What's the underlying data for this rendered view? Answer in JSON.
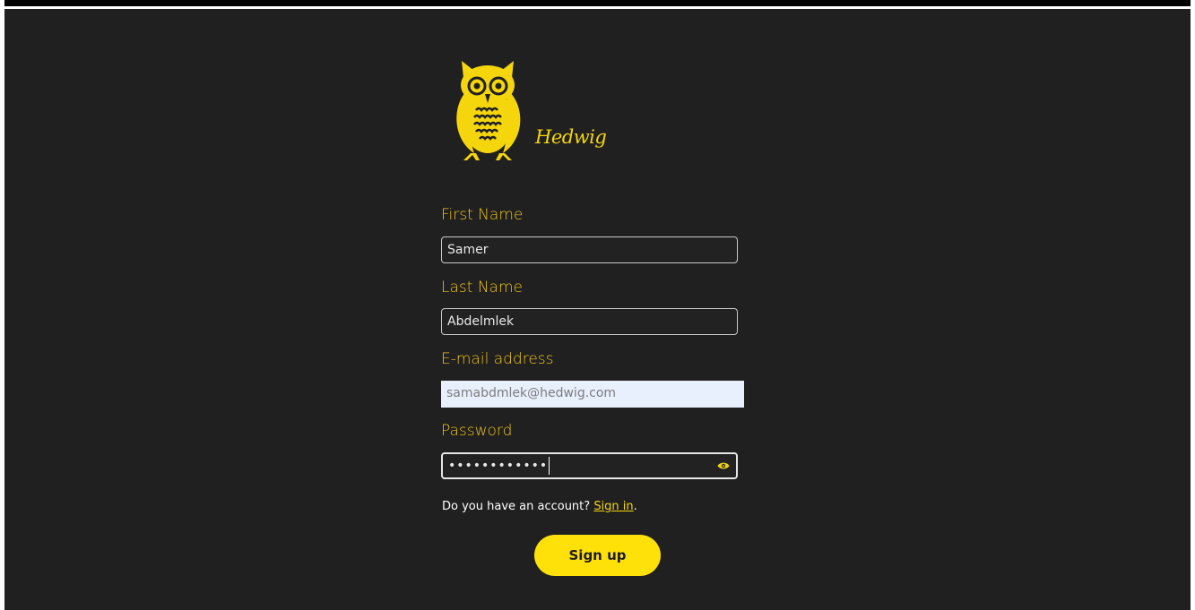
{
  "brand": {
    "name": "Hedwig",
    "accent_color": "#f5d60c",
    "logo_icon": "owl-icon"
  },
  "form": {
    "first_name": {
      "label": "First Name",
      "value": "Samer"
    },
    "last_name": {
      "label": "Last Name",
      "value": "Abdelmlek"
    },
    "email": {
      "label": "E-mail address",
      "value": "samabdmlek@hedwig.com"
    },
    "password": {
      "label": "Password",
      "value": "••••••••••••",
      "toggle_icon": "eye-icon"
    }
  },
  "account_prompt": {
    "text": "Do you have an account? ",
    "link": "Sign in",
    "suffix": "."
  },
  "submit": {
    "label": "Sign up"
  },
  "colors": {
    "background": "#202020",
    "label": "#f0c419",
    "button": "#ffe10a"
  }
}
